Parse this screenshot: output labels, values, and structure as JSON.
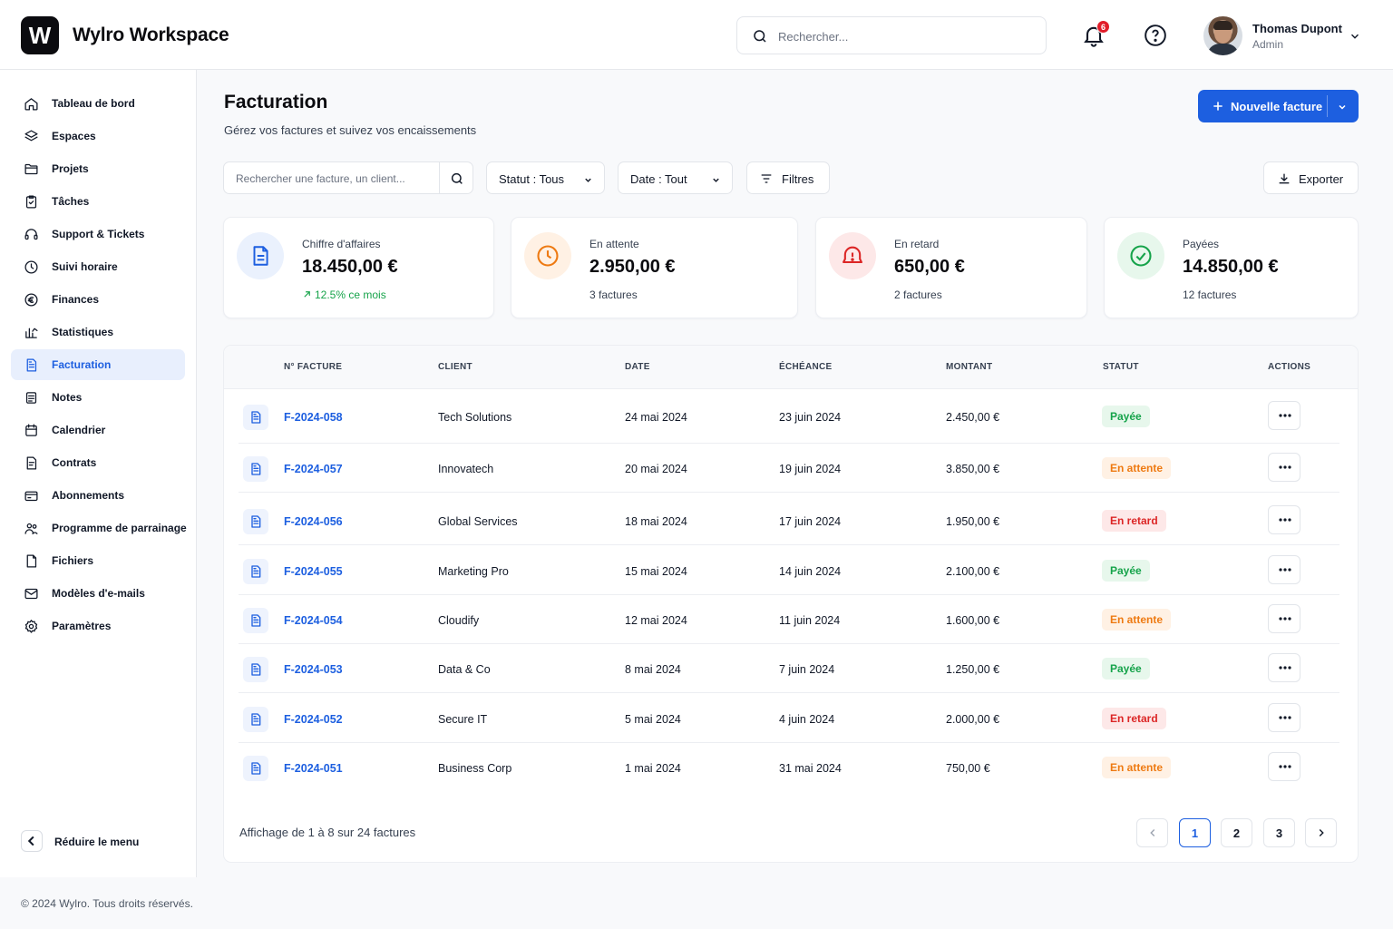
{
  "app": {
    "logo_letter": "W",
    "title": "Wylro Workspace"
  },
  "header": {
    "search_placeholder": "Rechercher...",
    "notification_count": "6",
    "user": {
      "name": "Thomas Dupont",
      "role": "Admin"
    }
  },
  "sidebar": {
    "items": [
      {
        "label": "Tableau de bord",
        "icon": "home-icon"
      },
      {
        "label": "Espaces",
        "icon": "layers-icon"
      },
      {
        "label": "Projets",
        "icon": "folder-icon"
      },
      {
        "label": "Tâches",
        "icon": "clipboard-check-icon"
      },
      {
        "label": "Support & Tickets",
        "icon": "headset-icon"
      },
      {
        "label": "Suivi horaire",
        "icon": "clock-icon"
      },
      {
        "label": "Finances",
        "icon": "euro-icon"
      },
      {
        "label": "Statistiques",
        "icon": "chart-icon"
      },
      {
        "label": "Facturation",
        "icon": "document-icon",
        "active": true
      },
      {
        "label": "Notes",
        "icon": "note-icon"
      },
      {
        "label": "Calendrier",
        "icon": "calendar-icon"
      },
      {
        "label": "Contrats",
        "icon": "contract-icon"
      },
      {
        "label": "Abonnements",
        "icon": "card-icon"
      },
      {
        "label": "Programme de parrainage",
        "icon": "users-icon"
      },
      {
        "label": "Fichiers",
        "icon": "file-icon"
      },
      {
        "label": "Modèles d'e-mails",
        "icon": "mail-icon"
      },
      {
        "label": "Paramètres",
        "icon": "gear-icon"
      }
    ],
    "collapse_label": "Réduire le menu"
  },
  "footer": {
    "copyright": "© 2024 Wylro. Tous droits réservés."
  },
  "page": {
    "title": "Facturation",
    "subtitle": "Gérez vos factures et suivez vos encaissements",
    "new_button": "Nouvelle facture"
  },
  "filters": {
    "search_placeholder": "Rechercher une facture, un client...",
    "status": "Statut : Tous",
    "date": "Date : Tout",
    "filters_label": "Filtres",
    "export_label": "Exporter"
  },
  "stats": [
    {
      "label": "Chiffre d'affaires",
      "value": "18.450,00 €",
      "sub": "12.5% ce mois",
      "color": "#1d5fe0",
      "bg": "#eaf1fd"
    },
    {
      "label": "En attente",
      "value": "2.950,00 €",
      "sub": "3 factures",
      "color": "#ee7a12",
      "bg": "#fff1e4"
    },
    {
      "label": "En retard",
      "value": "650,00 €",
      "sub": "2 factures",
      "color": "#dc2626",
      "bg": "#fde8e8"
    },
    {
      "label": "Payées",
      "value": "14.850,00 €",
      "sub": "12 factures",
      "color": "#16a34a",
      "bg": "#e7f7ec"
    }
  ],
  "table": {
    "columns": [
      "N° FACTURE",
      "CLIENT",
      "DATE",
      "ÉCHÉANCE",
      "MONTANT",
      "STATUT",
      "ACTIONS"
    ],
    "rows": [
      {
        "id": "F-2024-058",
        "client": "Tech Solutions",
        "date": "24 mai 2024",
        "due": "23 juin 2024",
        "amount": "2.450,00 €",
        "status": "Payée",
        "kind": "paid"
      },
      {
        "id": "F-2024-057",
        "client": "Innovatech",
        "date": "20 mai 2024",
        "due": "19 juin 2024",
        "amount": "3.850,00 €",
        "status": "En attente",
        "kind": "pending"
      },
      {
        "id": "F-2024-056",
        "client": "Global Services",
        "date": "18 mai 2024",
        "due": "17 juin 2024",
        "amount": "1.950,00 €",
        "status": "En retard",
        "kind": "late"
      },
      {
        "id": "F-2024-055",
        "client": "Marketing Pro",
        "date": "15 mai 2024",
        "due": "14 juin 2024",
        "amount": "2.100,00 €",
        "status": "Payée",
        "kind": "paid"
      },
      {
        "id": "F-2024-054",
        "client": "Cloudify",
        "date": "12 mai 2024",
        "due": "11 juin 2024",
        "amount": "1.600,00 €",
        "status": "En attente",
        "kind": "pending"
      },
      {
        "id": "F-2024-053",
        "client": "Data & Co",
        "date": "8 mai 2024",
        "due": "7 juin 2024",
        "amount": "1.250,00 €",
        "status": "Payée",
        "kind": "paid"
      },
      {
        "id": "F-2024-052",
        "client": "Secure IT",
        "date": "5 mai 2024",
        "due": "4 juin 2024",
        "amount": "2.000,00 €",
        "status": "En retard",
        "kind": "late"
      },
      {
        "id": "F-2024-051",
        "client": "Business Corp",
        "date": "1 mai 2024",
        "due": "31 mai 2024",
        "amount": "750,00 €",
        "status": "En attente",
        "kind": "pending"
      }
    ]
  },
  "pagination": {
    "info": "Affichage de 1 à 8 sur 24 factures",
    "pages": [
      "1",
      "2",
      "3"
    ],
    "current": "1"
  }
}
